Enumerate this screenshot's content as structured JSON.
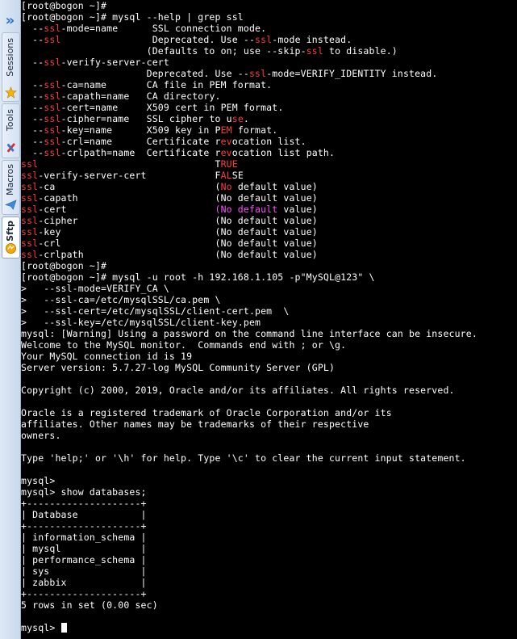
{
  "sidebar": {
    "expand_icon": "double-chevron-right-icon",
    "tabs": [
      {
        "label": "Sessions",
        "icon": "star-icon"
      },
      {
        "label": "Tools",
        "icon": "tools-icon"
      },
      {
        "label": "Macros",
        "icon": "paper-plane-icon"
      },
      {
        "label": "Sftp",
        "icon": "sftp-globe-icon",
        "active": true
      }
    ]
  },
  "colors": {
    "background": "#000000",
    "text": "#ffffff",
    "ssl_highlight": "#ff3b3b",
    "default_highlight": "#ff4fff",
    "cursor": "#ffffff"
  },
  "terminal": {
    "lines": [
      [
        [
          "w",
          "[root@bogon ~]#"
        ]
      ],
      [
        [
          "w",
          "[root@bogon ~]# mysql --help | grep ssl"
        ]
      ],
      [
        [
          "w",
          "  --"
        ],
        [
          "r",
          "ssl"
        ],
        [
          "w",
          "-mode=name      SSL connection mode."
        ]
      ],
      [
        [
          "w",
          "  --"
        ],
        [
          "r",
          "ssl"
        ],
        [
          "w",
          "                Deprecated. Use --"
        ],
        [
          "r",
          "ssl"
        ],
        [
          "w",
          "-mode instead."
        ]
      ],
      [
        [
          "w",
          "                      (Defaults to on; use --skip-"
        ],
        [
          "r",
          "ssl"
        ],
        [
          "w",
          " to disable.)"
        ]
      ],
      [
        [
          "w",
          "  --"
        ],
        [
          "r",
          "ssl"
        ],
        [
          "w",
          "-verify-server-cert"
        ]
      ],
      [
        [
          "w",
          "                      Deprecated. Use --"
        ],
        [
          "r",
          "ssl"
        ],
        [
          "w",
          "-mode=VERIFY_IDENTITY instead."
        ]
      ],
      [
        [
          "w",
          "  --"
        ],
        [
          "r",
          "ssl"
        ],
        [
          "w",
          "-ca=name       CA file in PEM format."
        ]
      ],
      [
        [
          "w",
          "  --"
        ],
        [
          "r",
          "ssl"
        ],
        [
          "w",
          "-capath=name   CA directory."
        ]
      ],
      [
        [
          "w",
          "  --"
        ],
        [
          "r",
          "ssl"
        ],
        [
          "w",
          "-cert=name     X509 cert in PEM format."
        ]
      ],
      [
        [
          "w",
          "  --"
        ],
        [
          "r",
          "ssl"
        ],
        [
          "w",
          "-cipher=name   SSL cipher to u"
        ],
        [
          "r",
          "se"
        ],
        [
          "w",
          "."
        ]
      ],
      [
        [
          "w",
          "  --"
        ],
        [
          "r",
          "ssl"
        ],
        [
          "w",
          "-key=name      X509 key in P"
        ],
        [
          "r",
          "EM"
        ],
        [
          "w",
          " format."
        ]
      ],
      [
        [
          "w",
          "  --"
        ],
        [
          "r",
          "ssl"
        ],
        [
          "w",
          "-crl=name      Certificate r"
        ],
        [
          "r",
          "ev"
        ],
        [
          "w",
          "ocation list."
        ]
      ],
      [
        [
          "w",
          "  --"
        ],
        [
          "r",
          "ssl"
        ],
        [
          "w",
          "-crlpath=name  Certificate r"
        ],
        [
          "r",
          "ev"
        ],
        [
          "w",
          "ocation list path."
        ]
      ],
      [
        [
          "r",
          "ssl"
        ],
        [
          "w",
          "                               T"
        ],
        [
          "r",
          "RUE"
        ]
      ],
      [
        [
          "r",
          "ssl"
        ],
        [
          "w",
          "-verify-server-cert            F"
        ],
        [
          "r",
          "AL"
        ],
        [
          "w",
          "SE"
        ]
      ],
      [
        [
          "r",
          "ssl"
        ],
        [
          "w",
          "-ca                            ("
        ],
        [
          "r",
          "No"
        ],
        [
          "w",
          " default value)"
        ]
      ],
      [
        [
          "r",
          "ssl"
        ],
        [
          "w",
          "-capath                        (No default value)"
        ]
      ],
      [
        [
          "r",
          "ssl"
        ],
        [
          "w",
          "-cert                          "
        ],
        [
          "m",
          "(No default"
        ],
        [
          "w",
          " value)"
        ]
      ],
      [
        [
          "r",
          "ssl"
        ],
        [
          "w",
          "-cipher                        (No default value)"
        ]
      ],
      [
        [
          "r",
          "ssl"
        ],
        [
          "w",
          "-key                           (No default value)"
        ]
      ],
      [
        [
          "r",
          "ssl"
        ],
        [
          "w",
          "-crl                           (No default value)"
        ]
      ],
      [
        [
          "r",
          "ssl"
        ],
        [
          "w",
          "-crlpath                       (No default value)"
        ]
      ],
      [
        [
          "w",
          "[root@bogon ~]#"
        ]
      ],
      [
        [
          "w",
          "[root@bogon ~]# mysql -u root -h 192.168.1.105 -p\"MySQL@123\" \\"
        ]
      ],
      [
        [
          "w",
          ">   --ssl-mode=VERIFY_CA \\"
        ]
      ],
      [
        [
          "w",
          ">   --ssl-ca=/etc/mysqlSSL/ca.pem \\"
        ]
      ],
      [
        [
          "w",
          ">   --ssl-cert=/etc/mysqlSSL/client-cert.pem  \\"
        ]
      ],
      [
        [
          "w",
          ">   --ssl-key=/etc/mysqlSSL/client-key.pem"
        ]
      ],
      [
        [
          "w",
          "mysql: [Warning] Using a password on the command line interface can be insecure."
        ]
      ],
      [
        [
          "w",
          "Welcome to the MySQL monitor.  Commands end with ; or \\g."
        ]
      ],
      [
        [
          "w",
          "Your MySQL connection id is 19"
        ]
      ],
      [
        [
          "w",
          "Server version: 5.7.27-log MySQL Community Server (GPL)"
        ]
      ],
      [
        [
          "w",
          ""
        ]
      ],
      [
        [
          "w",
          "Copyright (c) 2000, 2019, Oracle and/or its affiliates. All rights reserved."
        ]
      ],
      [
        [
          "w",
          ""
        ]
      ],
      [
        [
          "w",
          "Oracle is a registered trademark of Oracle Corporation and/or its"
        ]
      ],
      [
        [
          "w",
          "affiliates. Other names may be trademarks of their respective"
        ]
      ],
      [
        [
          "w",
          "owners."
        ]
      ],
      [
        [
          "w",
          ""
        ]
      ],
      [
        [
          "w",
          "Type 'help;' or '\\h' for help. Type '\\c' to clear the current input statement."
        ]
      ],
      [
        [
          "w",
          ""
        ]
      ],
      [
        [
          "w",
          "mysql>"
        ]
      ],
      [
        [
          "w",
          "mysql> show databases;"
        ]
      ],
      [
        [
          "w",
          "+--------------------+"
        ]
      ],
      [
        [
          "w",
          "| Database           |"
        ]
      ],
      [
        [
          "w",
          "+--------------------+"
        ]
      ],
      [
        [
          "w",
          "| information_schema |"
        ]
      ],
      [
        [
          "w",
          "| mysql              |"
        ]
      ],
      [
        [
          "w",
          "| performance_schema |"
        ]
      ],
      [
        [
          "w",
          "| sys                |"
        ]
      ],
      [
        [
          "w",
          "| zabbix             |"
        ]
      ],
      [
        [
          "w",
          "+--------------------+"
        ]
      ],
      [
        [
          "w",
          "5 rows in set (0.00 sec)"
        ]
      ],
      [
        [
          "w",
          ""
        ]
      ],
      [
        [
          "w",
          "mysql> "
        ]
      ]
    ]
  }
}
